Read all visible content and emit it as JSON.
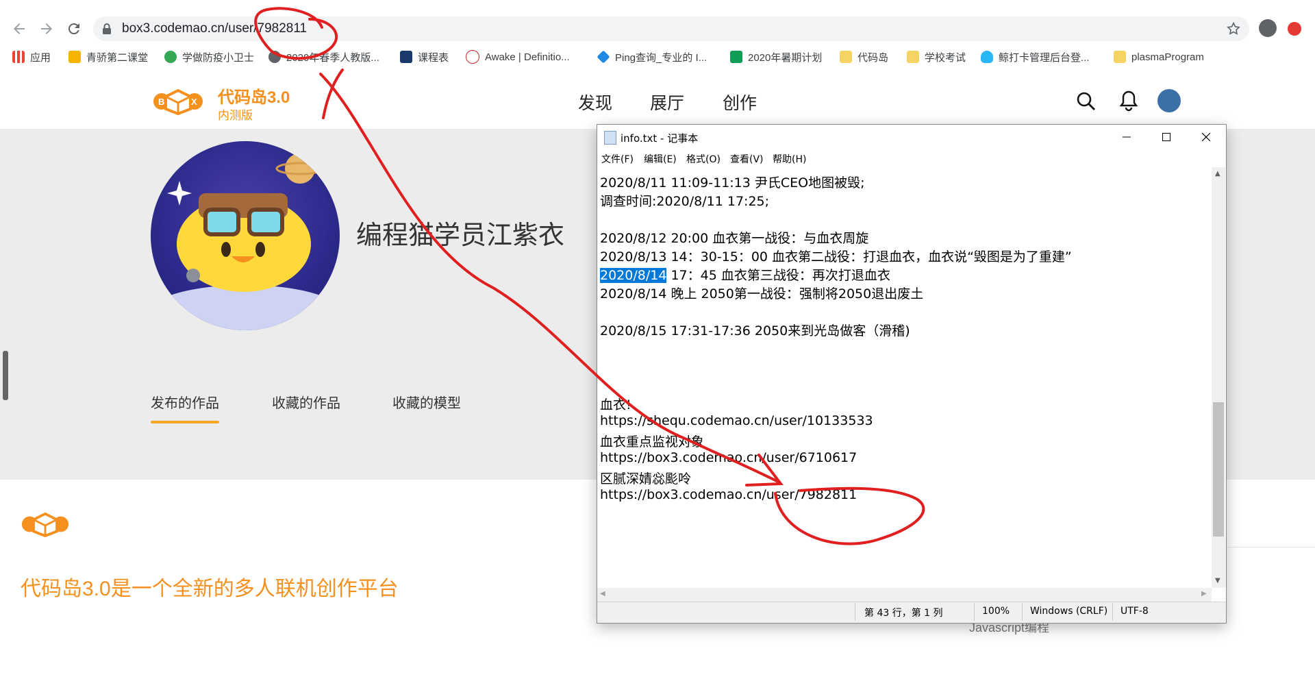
{
  "browser": {
    "url_host": "box3.codemao.cn",
    "url_path": "/user/7982811",
    "bookmarks": [
      {
        "label": "应用",
        "icon": "apps-grid-icon"
      },
      {
        "label": "青骄第二课堂",
        "icon": "trophy-icon"
      },
      {
        "label": "学做防疫小卫士",
        "icon": "clover-icon"
      },
      {
        "label": "2020年春季人教版...",
        "icon": "globe-icon"
      },
      {
        "label": "课程表",
        "icon": "calendar-icon"
      },
      {
        "label": "Awake | Definitio...",
        "icon": "mw-icon"
      },
      {
        "label": "Ping查询_专业的 I...",
        "icon": "diamond-icon"
      },
      {
        "label": "2020年暑期计划",
        "icon": "sheets-icon"
      },
      {
        "label": "代码岛",
        "icon": "folder-icon"
      },
      {
        "label": "学校考试",
        "icon": "folder-icon"
      },
      {
        "label": "鲸打卡管理后台登...",
        "icon": "whale-icon"
      },
      {
        "label": "plasmaProgram",
        "icon": "folder-icon"
      }
    ]
  },
  "site": {
    "logo_title": "代码岛3.0",
    "logo_sub": "内测版",
    "nav": [
      "发现",
      "展厅",
      "创作"
    ],
    "username": "编程猫学员江紫衣",
    "profile_tabs": [
      "发布的作品",
      "收藏的作品",
      "收藏的模型"
    ],
    "footer_tagline": "代码岛3.0是一个全新的多人联机创作平台",
    "footer_link": "Javascript编程"
  },
  "notepad": {
    "title": "info.txt - 记事本",
    "menu": [
      "文件(F)",
      "编辑(E)",
      "格式(O)",
      "查看(V)",
      "帮助(H)"
    ],
    "lines": [
      "2020/8/11 11:09-11:13 尹氏CEO地图被毁;",
      "调查时间:2020/8/11 17:25;",
      "",
      "2020/8/12 20:00 血衣第一战役：与血衣周旋",
      "2020/8/13 14：30-15：00 血衣第二战役：打退血衣，血衣说“毁图是为了重建”",
      "2020/8/14 17：45 血衣第三战役：再次打退血衣",
      "2020/8/14 晚上 2050第一战役：强制将2050退出废土",
      "",
      "2020/8/15 17:31-17:36 2050来到光岛做客（滑稽)",
      "",
      "",
      "",
      "血衣!",
      "https://shequ.codemao.cn/user/10133533",
      "血衣重点监视对象",
      "https://box3.codemao.cn/user/6710617",
      "区腻深婧惢颩呤",
      "https://box3.codemao.cn/user/7982811"
    ],
    "selected_text": "2020/8/14",
    "selected_rest": " 17：45 血衣第三战役：再次打退血衣",
    "status": {
      "position": "第 43 行，第 1 列",
      "zoom": "100%",
      "line_ending": "Windows (CRLF)",
      "encoding": "UTF-8"
    }
  },
  "annotation_color": "#e02020"
}
